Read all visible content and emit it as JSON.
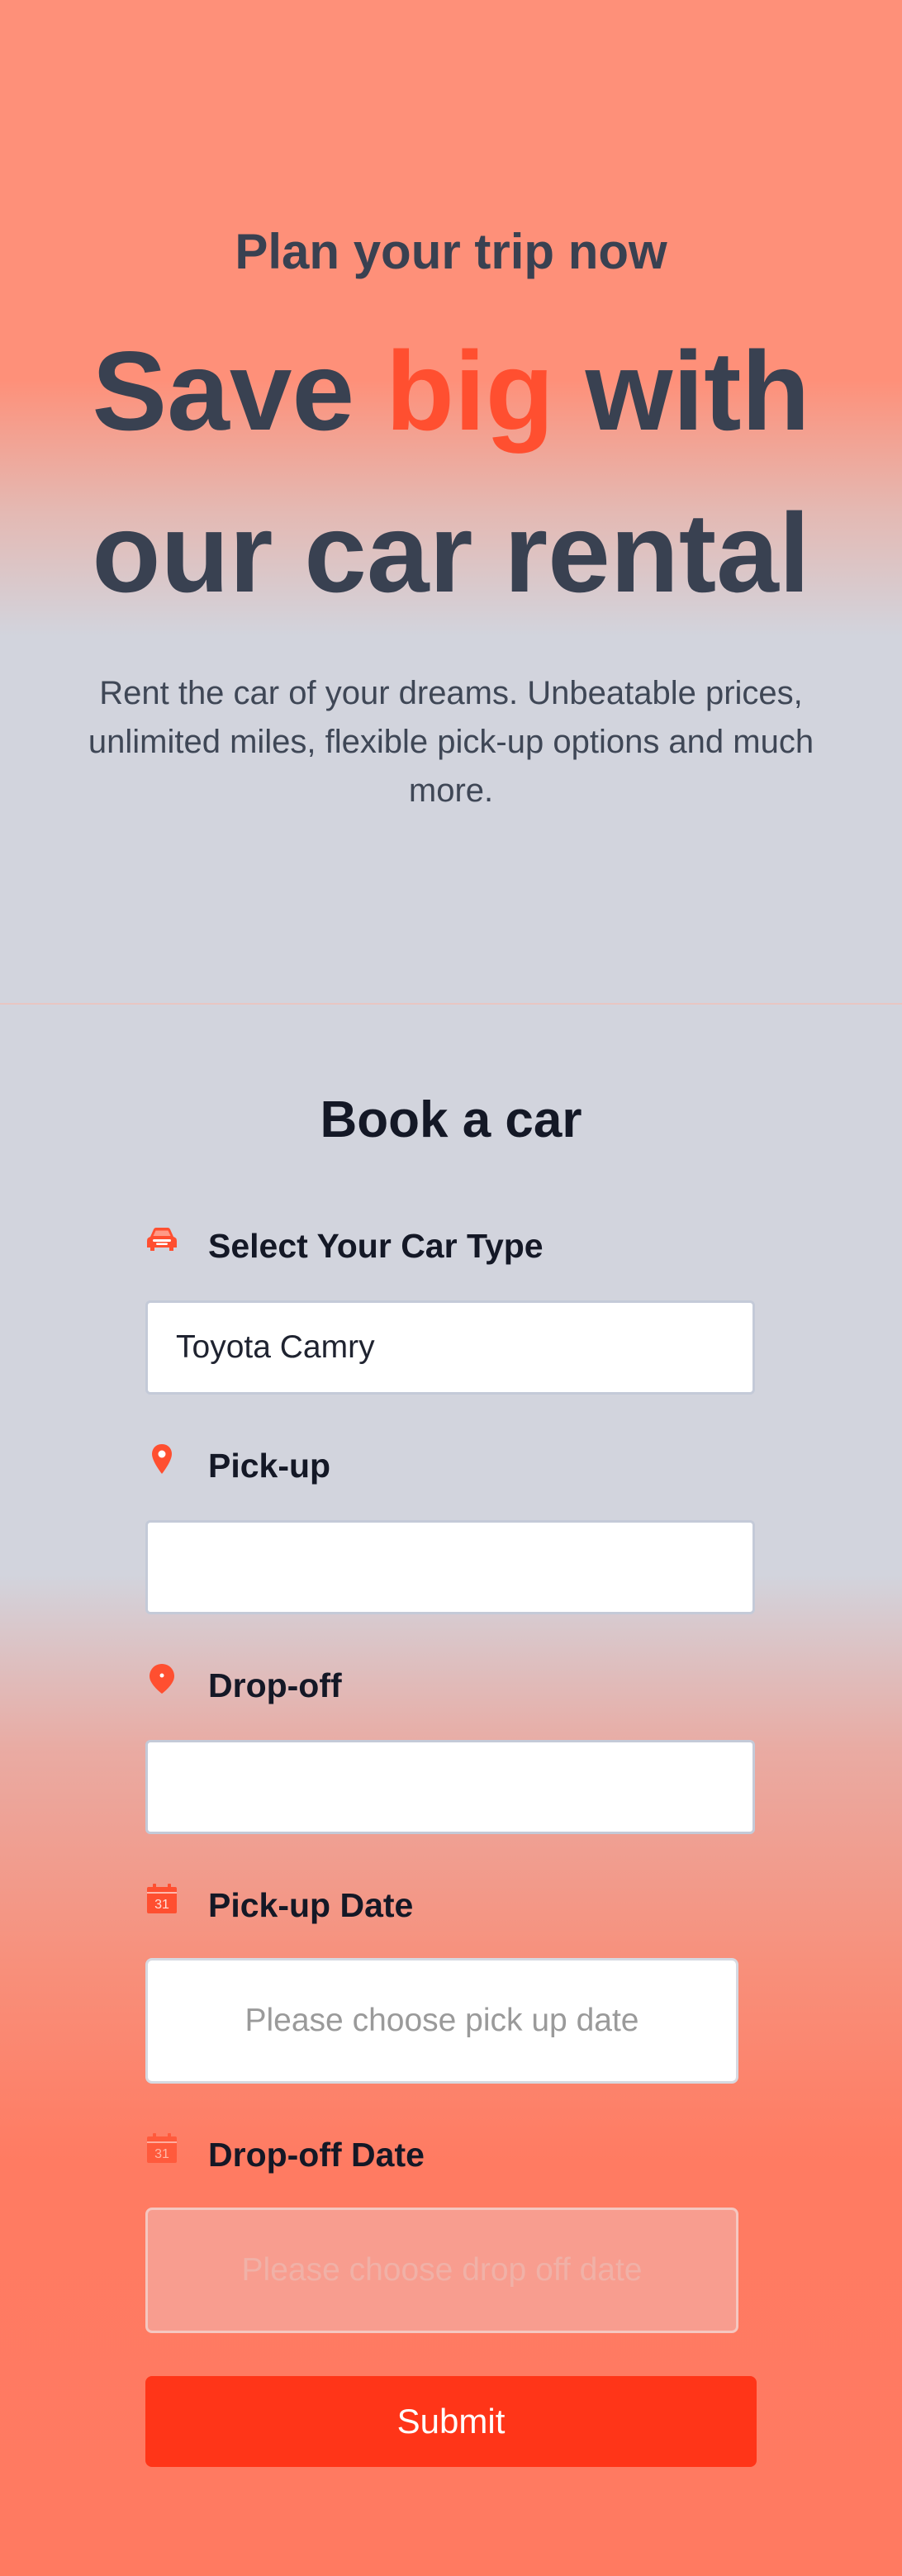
{
  "hero": {
    "subtitle": "Plan your trip now",
    "title_part1": "Save ",
    "title_accent": "big",
    "title_part2": " with our car rental",
    "description": "Rent the car of your dreams. Unbeatable prices, unlimited miles, flexible pick-up options and much more."
  },
  "booking": {
    "title": "Book a car",
    "car_type": {
      "label": "Select Your Car Type",
      "value": "Toyota Camry",
      "icon": "car-icon"
    },
    "pickup": {
      "label": "Pick-up",
      "value": "",
      "icon": "map-pin-icon"
    },
    "dropoff": {
      "label": "Drop-off",
      "value": "",
      "icon": "map-pin-icon"
    },
    "pickup_date": {
      "label": "Pick-up Date",
      "placeholder": "Please choose pick up date",
      "icon": "calendar-icon",
      "icon_text": "31"
    },
    "dropoff_date": {
      "label": "Drop-off Date",
      "placeholder": "Please choose drop off date",
      "icon": "calendar-icon",
      "icon_text": "31"
    },
    "submit_label": "Submit"
  },
  "colors": {
    "accent": "#ff4f30",
    "button": "#ff3518",
    "heading": "#394151"
  }
}
